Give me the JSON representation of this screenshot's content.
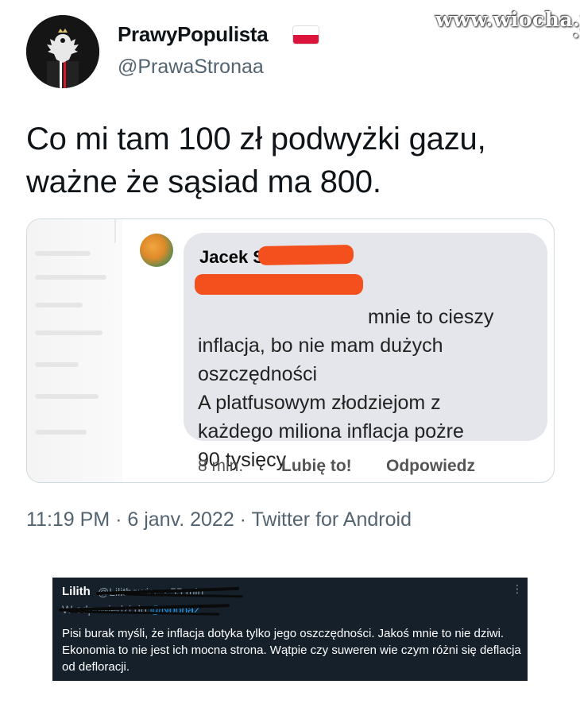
{
  "watermark": {
    "text": "www.wiocha.pl"
  },
  "tweet": {
    "display_name": "PrawyPopulista",
    "flag_icon": "poland-flag-icon",
    "handle": "@PrawaStronaa",
    "text_lines": [
      "Co mi tam 100 zł podwyżki gazu,",
      "ważne że sąsiad ma 800."
    ],
    "meta": "11:19 PM · 6 janv. 2022 · Twitter for Android"
  },
  "facebook_comment": {
    "author": "Jacek S",
    "body": "mnie to cieszy\ninflacja, bo nie mam dużych\noszczędności\nA platfusowym złodziejom z\nkażdego miliona inflacja pożre\n90 tysięcy",
    "time": "8 min.",
    "like": "Lubię to!",
    "reply": "Odpowiedz"
  },
  "reply_tweet": {
    "name": "Lilith",
    "handle": "@Lilithowice · 55 min",
    "reply_to_prefix": "W odpowiedzi do",
    "reply_to_mention": "@NoonaZ",
    "text": "Pisi burak myśli, że inflacja dotyka tylko jego oszczędności. Jakoś mnie to nie dziwi. Ekonomia to nie jest ich mocna strona. Wątpie czy suweren wie czym różni się deflacja od defloracji.",
    "more_icon": "more-vertical-icon"
  },
  "colors": {
    "redaction": "#f4501e",
    "dark_bg": "#15202b",
    "link": "#1d9bf0",
    "secondary_text": "#536471"
  }
}
